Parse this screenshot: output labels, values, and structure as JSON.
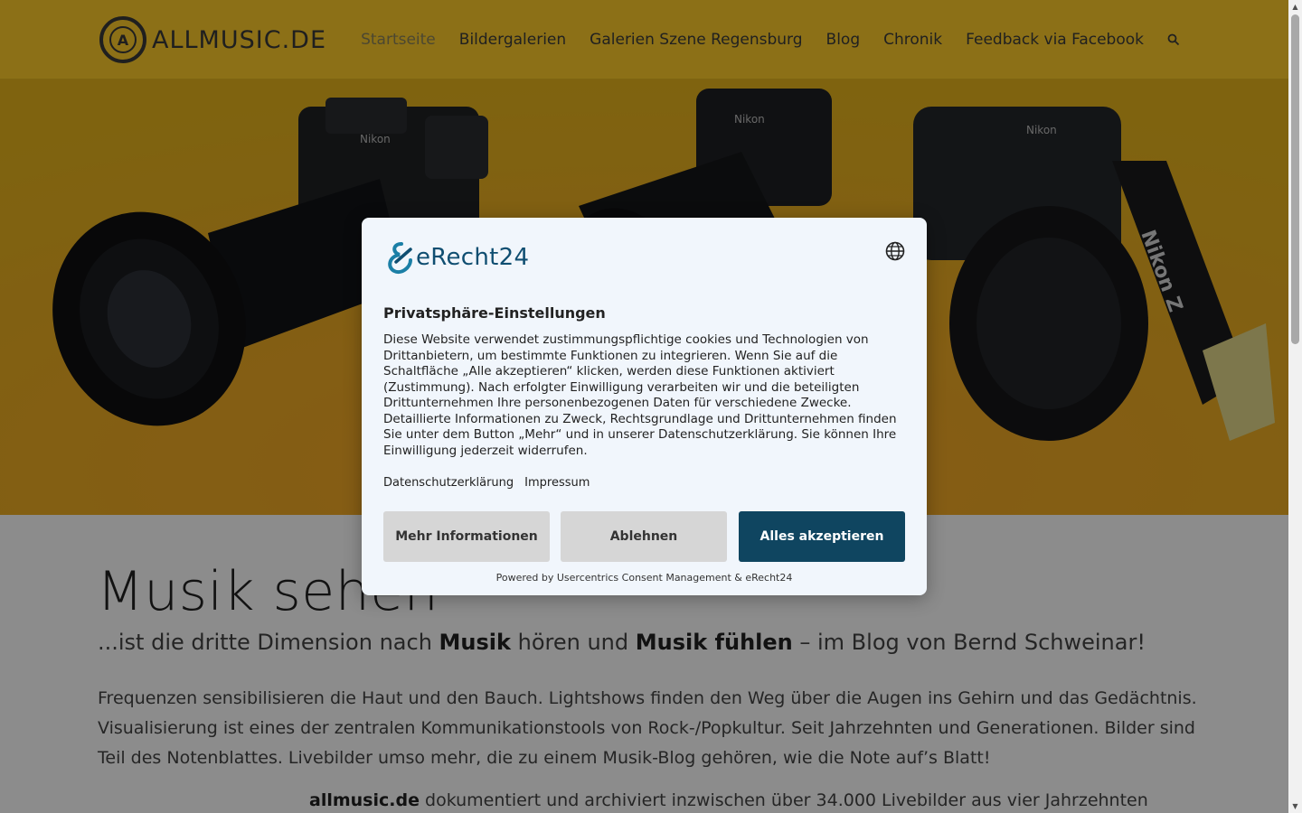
{
  "header": {
    "logo_text": "ALLMUSIC.DE",
    "logo_letter": "A",
    "nav": [
      {
        "label": "Startseite",
        "active": true
      },
      {
        "label": "Bildergalerien"
      },
      {
        "label": "Galerien Szene Regensburg"
      },
      {
        "label": "Blog"
      },
      {
        "label": "Chronik"
      },
      {
        "label": "Feedback via Facebook"
      }
    ],
    "search_icon": "search-icon"
  },
  "hero": {
    "camera_brand_1": "Nikon",
    "camera_brand_2": "Nikon",
    "camera_brand_3": "Nikon",
    "strap_text": "Nikon Z"
  },
  "content": {
    "title": "Musik sehen",
    "subtitle_pre": "...ist die dritte Dimension nach ",
    "subtitle_b1": "Musik",
    "subtitle_mid": " hören und ",
    "subtitle_b2": "Musik fühlen",
    "subtitle_post": " – im Blog von Bernd Schweinar!",
    "paragraph": "Frequenzen sensibilisieren die Haut und den Bauch. Lightshows finden den Weg über die Augen ins Gehirn und das Gedächtnis. Visualisierung ist eines der zentralen Kommunikationstools von Rock-/Popkultur. Seit Jahrzehnten und Generationen. Bilder sind Teil des Notenblattes. Livebilder umso mehr, die zu einem Musik-Blog gehören, wie die Note auf’s Blatt!",
    "para2_b": "allmusic.de",
    "para2_rest": " dokumentiert und archiviert inzwischen über 34.000 Livebilder aus vier Jahrzehnten"
  },
  "consent": {
    "brand": "eRecht24",
    "title": "Privatsphäre-Einstellungen",
    "text": "Diese Website verwendet zustimmungspflichtige cookies und Technologien von Drittanbietern, um bestimmte Funktionen zu integrieren. Wenn Sie auf die Schaltfläche „Alle akzeptieren“ klicken, werden diese Funktionen aktiviert (Zustimmung). Nach erfolgter Einwilligung verarbeiten wir und die beteiligten Drittunternehmen Ihre personenbezogenen Daten für verschiedene Zwecke. Detaillierte Informationen zu Zweck, Rechtsgrundlage und Drittunternehmen finden Sie unter dem Button „Mehr“ und in unserer Datenschutzerklärung. Sie können Ihre Einwilligung jederzeit widerrufen.",
    "link_privacy": "Datenschutzerklärung",
    "link_imprint": "Impressum",
    "btn_more": "Mehr Informationen",
    "btn_deny": "Ablehnen",
    "btn_accept": "Alles akzeptieren",
    "powered": "Powered by Usercentrics Consent Management & eRecht24",
    "primary_color": "#0f4560"
  }
}
